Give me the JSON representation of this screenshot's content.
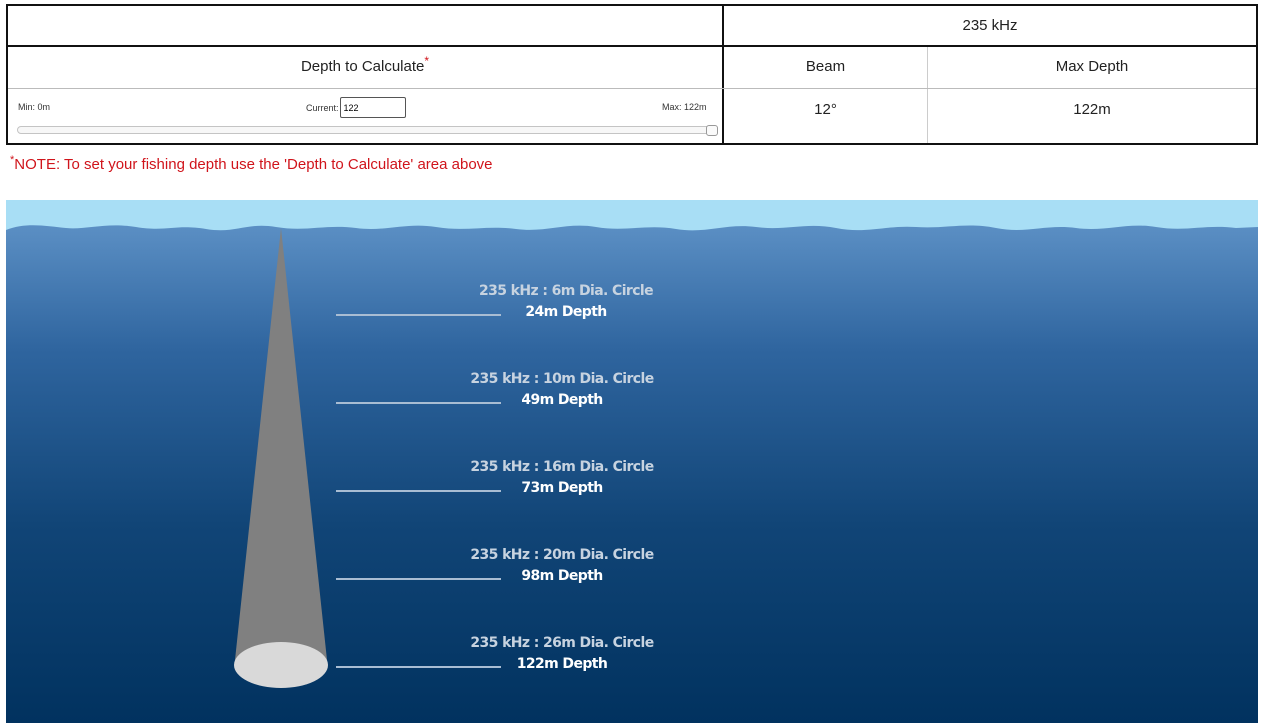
{
  "table": {
    "frequency_header": "235 kHz",
    "depth_header": "Depth to Calculate",
    "beam_header": "Beam",
    "max_depth_header": "Max Depth",
    "beam_value": "12°",
    "max_depth_value": "122m",
    "required_marker": "*"
  },
  "depth_control": {
    "min_label": "Min: 0m",
    "current_label": "Current:",
    "current_value": "122",
    "max_label": "Max: 122m",
    "slider_fraction": 1.0
  },
  "note": {
    "marker": "*",
    "text": "NOTE: To set your fishing depth use the 'Depth to Calculate' area above"
  },
  "annotations": [
    {
      "circle": "235 kHz : 6m Dia. Circle",
      "depth": "24m Depth"
    },
    {
      "circle": "235 kHz : 10m Dia. Circle",
      "depth": "49m Depth"
    },
    {
      "circle": "235 kHz : 16m Dia. Circle",
      "depth": "73m Depth"
    },
    {
      "circle": "235 kHz : 20m Dia. Circle",
      "depth": "98m Depth"
    },
    {
      "circle": "235 kHz : 26m Dia. Circle",
      "depth": "122m Depth"
    }
  ],
  "colors": {
    "accent_red": "#d0141b",
    "sky": "#a8def5",
    "water_top": "#4f86bd",
    "water_bottom": "#01325f",
    "beam": "#808080",
    "beam_footprint": "#d9d9d9"
  }
}
